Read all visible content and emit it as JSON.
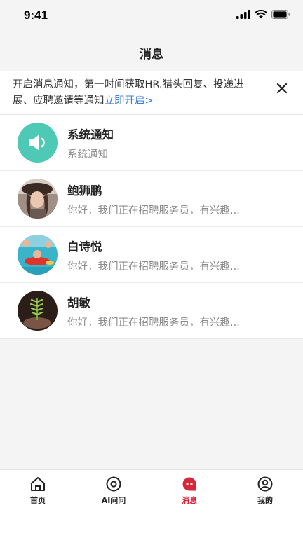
{
  "status_bar": {
    "time": "9:41"
  },
  "header": {
    "title": "消息"
  },
  "notice": {
    "text": "开启消息通知，第一时间获取HR.猎头回复、投递进展、应聘邀请等通知",
    "link": "立即开启>"
  },
  "conversations": [
    {
      "name": "系统通知",
      "message": "系统通知",
      "avatar": "speaker-icon"
    },
    {
      "name": "鲍狮鹏",
      "message": "你好，我们正在招聘服务员，有兴趣...",
      "avatar": "user-photo"
    },
    {
      "name": "白诗悦",
      "message": "你好，我们正在招聘服务员，有兴趣...",
      "avatar": "user-photo"
    },
    {
      "name": "胡敏",
      "message": "你好，我们正在招聘服务员，有兴趣...",
      "avatar": "user-photo"
    }
  ],
  "tabs": [
    {
      "label": "首页",
      "icon": "home-icon"
    },
    {
      "label": "AI问问",
      "icon": "ai-ask-icon"
    },
    {
      "label": "消息",
      "icon": "message-icon",
      "active": true
    },
    {
      "label": "我的",
      "icon": "profile-icon"
    }
  ],
  "colors": {
    "accent_red": "#d8263a",
    "link_blue": "#3d7fd6",
    "system_teal": "#4ec9b6"
  }
}
